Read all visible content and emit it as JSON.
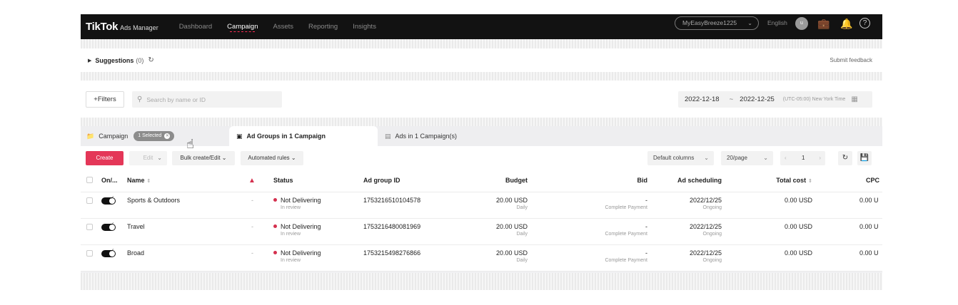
{
  "nav": {
    "logo": "TikTok",
    "logo_sub": "Ads Manager",
    "items": [
      "Dashboard",
      "Campaign",
      "Assets",
      "Reporting",
      "Insights"
    ],
    "active": "Campaign",
    "account": "MyEasyBreeze1225",
    "language": "English",
    "avatar_initial": "u",
    "icons": [
      "briefcase-icon",
      "bell-icon",
      "help-icon"
    ]
  },
  "suggestions": {
    "label": "Suggestions",
    "count": "(0)",
    "feedback": "Submit feedback"
  },
  "filters": {
    "button": "+Filters",
    "search_placeholder": "Search by name or ID",
    "date_start": "2022-12-18",
    "date_sep": "~",
    "date_end": "2022-12-25",
    "timezone": "(UTC-05:00) New York Time"
  },
  "tabs": {
    "campaign": "Campaign",
    "selected": "1 Selected",
    "ad_groups": "Ad Groups in 1 Campaign",
    "ads": "Ads in 1 Campaign(s)"
  },
  "toolbar": {
    "create": "Create",
    "edit": "Edit",
    "bulk": "Bulk create/Edit",
    "automated": "Automated rules",
    "columns": "Default columns",
    "per_page": "20/page",
    "page": "1"
  },
  "table": {
    "headers": {
      "onoff": "On/...",
      "name": "Name",
      "status": "Status",
      "ad_group_id": "Ad group ID",
      "budget": "Budget",
      "bid": "Bid",
      "scheduling": "Ad scheduling",
      "total_cost": "Total cost",
      "cpc": "CPC"
    },
    "rows": [
      {
        "name": "Sports & Outdoors",
        "warn": "-",
        "status": "Not Delivering",
        "status_sub": "In review",
        "id": "1753216510104578",
        "budget": "20.00 USD",
        "budget_sub": "Daily",
        "bid": "-",
        "bid_sub": "Complete Payment",
        "date": "2022/12/25",
        "date_sub": "Ongoing",
        "cost": "0.00 USD",
        "cpc": "0.00 U"
      },
      {
        "name": "Travel",
        "warn": "-",
        "status": "Not Delivering",
        "status_sub": "In review",
        "id": "1753216480081969",
        "budget": "20.00 USD",
        "budget_sub": "Daily",
        "bid": "-",
        "bid_sub": "Complete Payment",
        "date": "2022/12/25",
        "date_sub": "Ongoing",
        "cost": "0.00 USD",
        "cpc": "0.00 U"
      },
      {
        "name": "Broad",
        "warn": "-",
        "status": "Not Delivering",
        "status_sub": "In review",
        "id": "1753215498276866",
        "budget": "20.00 USD",
        "budget_sub": "Daily",
        "bid": "-",
        "bid_sub": "Complete Payment",
        "date": "2022/12/25",
        "date_sub": "Ongoing",
        "cost": "0.00 USD",
        "cpc": "0.00 U"
      }
    ]
  },
  "colors": {
    "accent": "#fe2c55",
    "create_button": "#e43758",
    "status_dot": "#d4304e",
    "nav_bg": "#121212"
  }
}
